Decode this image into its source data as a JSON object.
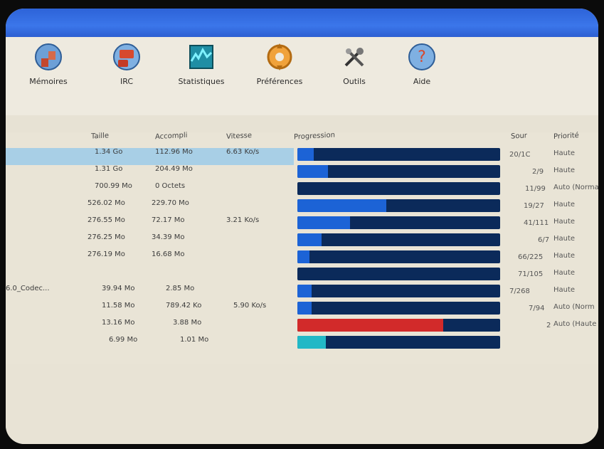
{
  "toolbar": {
    "tools": [
      {
        "id": "memories",
        "label": "Mémoires",
        "icon": "memory-icon"
      },
      {
        "id": "irc",
        "label": "IRC",
        "icon": "irc-icon"
      },
      {
        "id": "stats",
        "label": "Statistiques",
        "icon": "statistics-icon"
      },
      {
        "id": "prefs",
        "label": "Préférences",
        "icon": "preferences-icon"
      },
      {
        "id": "outils",
        "label": "Outils",
        "icon": "tools-icon"
      },
      {
        "id": "aide",
        "label": "Aide",
        "icon": "help-icon"
      }
    ]
  },
  "list": {
    "headers": {
      "taille": "Taille",
      "accompli": "Accompli",
      "vitesse": "Vitesse",
      "progression": "Progression",
      "sources": "Sour",
      "priorite": "Priorité"
    },
    "rows": [
      {
        "name": "",
        "size": "1.34 Go",
        "done": "112.96 Mo",
        "speed": "6.63 Ko/s",
        "sources": "20/1C",
        "priority": "Haute",
        "progress": 0.08,
        "bar": "#1c63d6"
      },
      {
        "name": "",
        "size": "1.31 Go",
        "done": "204.49 Mo",
        "speed": "",
        "sources": "2/9",
        "priority": "Haute",
        "progress": 0.15,
        "bar": "#1c63d6"
      },
      {
        "name": "",
        "size": "700.99 Mo",
        "done": "0 Octets",
        "speed": "",
        "sources": "11/99",
        "priority": "Auto (Norma",
        "progress": 0.0,
        "bar": "#1c63d6"
      },
      {
        "name": "",
        "size": "526.02 Mo",
        "done": "229.70 Mo",
        "speed": "",
        "sources": "19/27",
        "priority": "Haute",
        "progress": 0.44,
        "bar": "#1c63d6"
      },
      {
        "name": "",
        "size": "276.55 Mo",
        "done": "72.17 Mo",
        "speed": "3.21 Ko/s",
        "sources": "41/111",
        "priority": "Haute",
        "progress": 0.26,
        "bar": "#1c63d6"
      },
      {
        "name": "",
        "size": "276.25 Mo",
        "done": "34.39 Mo",
        "speed": "",
        "sources": "6/7",
        "priority": "Haute",
        "progress": 0.12,
        "bar": "#1c63d6"
      },
      {
        "name": "",
        "size": "276.19 Mo",
        "done": "16.68 Mo",
        "speed": "",
        "sources": "66/225",
        "priority": "Haute",
        "progress": 0.06,
        "bar": "#1c63d6"
      },
      {
        "name": "",
        "size": "",
        "done": "",
        "speed": "",
        "sources": "71/105",
        "priority": "Haute",
        "progress": 0.0,
        "bar": "#1c63d6"
      },
      {
        "name": "6.0_Codec...",
        "size": "39.94 Mo",
        "done": "2.85 Mo",
        "speed": "",
        "sources": "7/268",
        "priority": "Haute",
        "progress": 0.07,
        "bar": "#1c63d6"
      },
      {
        "name": "",
        "size": "11.58 Mo",
        "done": "789.42 Ko",
        "speed": "5.90 Ko/s",
        "sources": "7/94",
        "priority": "Auto (Norm",
        "progress": 0.07,
        "bar": "#1c63d6"
      },
      {
        "name": "",
        "size": "13.16 Mo",
        "done": "3.88 Mo",
        "speed": "",
        "sources": "2",
        "priority": "Auto (Haute",
        "progress": 0.72,
        "bar": "#d22a2a"
      },
      {
        "name": "",
        "size": "6.99 Mo",
        "done": "1.01 Mo",
        "speed": "",
        "sources": "",
        "priority": "",
        "progress": 0.14,
        "bar": "#22b8c6"
      }
    ]
  },
  "colors": {
    "accent": "#2d63d8",
    "bar_blue": "#1c63d6",
    "bar_dark": "#0b2a5a",
    "bar_red": "#d22a2a",
    "bar_cyan": "#22b8c6",
    "selected_row": "#a8cfe6"
  }
}
